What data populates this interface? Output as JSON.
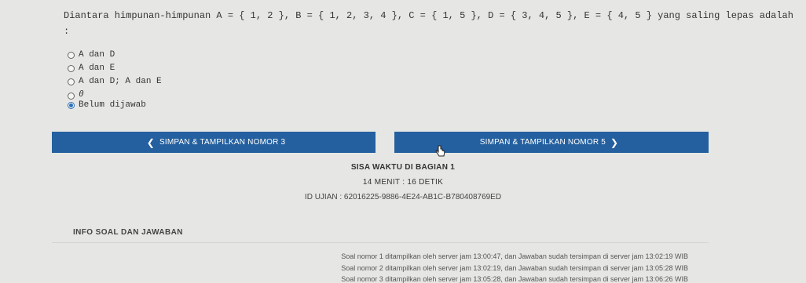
{
  "question": {
    "text": "Diantara himpunan-himpunan A = { 1, 2 }, B = { 1, 2, 3, 4 }, C = { 1, 5 }, D = { 3, 4, 5 }, E = { 4, 5 } yang saling lepas adalah :"
  },
  "options": [
    {
      "label": "A dan D",
      "selected": false
    },
    {
      "label": "A dan E",
      "selected": false
    },
    {
      "label": "A dan D; A dan E",
      "selected": false
    },
    {
      "label": "θ",
      "selected": false
    },
    {
      "label": "Belum dijawab",
      "selected": true
    }
  ],
  "nav": {
    "prev_label": "SIMPAN & TAMPILKAN NOMOR 3",
    "next_label": "SIMPAN & TAMPILKAN NOMOR 5",
    "prev_icon": "chevron-left",
    "next_icon": "chevron-right",
    "color": "#24609f"
  },
  "timer": {
    "section": "SISA WAKTU DI BAGIAN 1",
    "remaining": "14 MENIT : 16 DETIK",
    "exam_id": "ID UJIAN : 62016225-9886-4E24-AB1C-B780408769ED"
  },
  "info": {
    "title": "INFO SOAL DAN JAWABAN",
    "logs": [
      "Soal nomor 1 ditampilkan oleh server jam 13:00:47, dan Jawaban sudah tersimpan di server jam 13:02:19 WIB",
      "Soal nomor 2 ditampilkan oleh server jam 13:02:19, dan Jawaban sudah tersimpan di server jam 13:05:28 WIB",
      "Soal nomor 3 ditampilkan oleh server jam 13:05:28, dan Jawaban sudah tersimpan di server jam 13:06:26 WIB"
    ]
  }
}
